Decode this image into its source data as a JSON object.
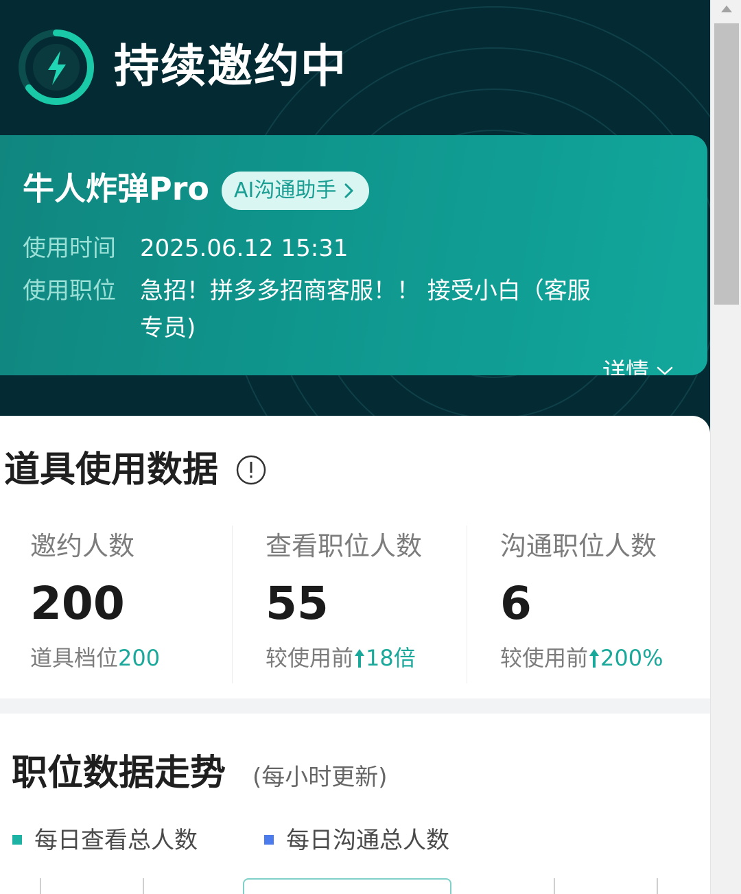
{
  "hero": {
    "status_title": "持续邀约中"
  },
  "tool_card": {
    "name": "牛人炸弹Pro",
    "ai_button": "AI沟通助手",
    "detail_link": "详情",
    "usage_time_label": "使用时间",
    "usage_time_value": "2025.06.12 15:31",
    "usage_position_label": "使用职位",
    "usage_position_value": "急招！拼多多招商客服！！ 接受小白（客服专员)"
  },
  "stats": {
    "title": "道具使用数据",
    "items": [
      {
        "label": "邀约人数",
        "value": "200",
        "sub_prefix": "道具档位",
        "sub_value": "200",
        "has_arrow": false
      },
      {
        "label": "查看职位人数",
        "value": "55",
        "sub_prefix": "较使用前",
        "sub_value": "18倍",
        "has_arrow": true
      },
      {
        "label": "沟通职位人数",
        "value": "6",
        "sub_prefix": "较使用前",
        "sub_value": "200%",
        "has_arrow": true
      }
    ]
  },
  "trend": {
    "title": "职位数据走势",
    "note": "(每小时更新)",
    "legend": [
      {
        "label": "每日查看总人数",
        "color": "#1db3a4"
      },
      {
        "label": "每日沟通总人数",
        "color": "#4b7bec"
      }
    ]
  },
  "colors": {
    "hero_bg": "#042b33",
    "card_teal": "#0f968d",
    "accent": "#1aa89b"
  },
  "icons": {
    "status": "lightning-icon",
    "ai_chevron": "chevron-right-icon",
    "detail_chevron": "chevron-down-icon",
    "info": "info-icon",
    "trend_arrow": "arrow-up-icon"
  }
}
